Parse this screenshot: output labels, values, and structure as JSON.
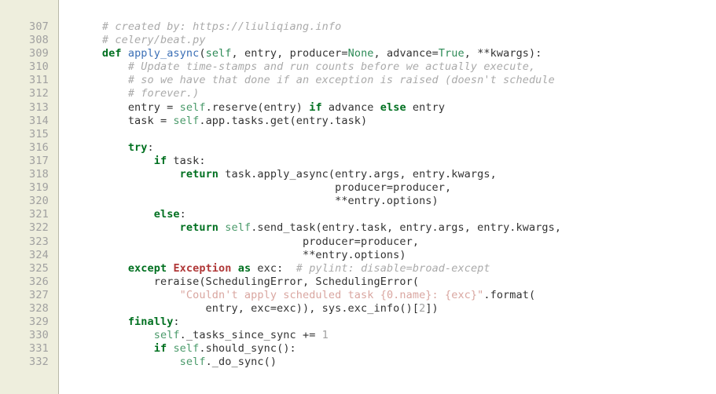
{
  "editor": {
    "name": "code-viewer",
    "language": "python",
    "theme_colors": {
      "background": "#ffffff",
      "gutter_background": "#eeeedd",
      "gutter_border": "#b8b8a8",
      "line_number": "#a0a0a0",
      "text": "#333333",
      "comment": "#aaaaaa",
      "keyword": "#007020",
      "constant": "#2e8b57",
      "self": "#4a9a6a",
      "function_name": "#3b6fb6",
      "exception": "#b03838",
      "string": "#d9a6a0",
      "number": "#a0a0a0"
    },
    "first_line_number": 307,
    "last_line_number": 332,
    "line_numbers": [
      "307",
      "308",
      "309",
      "310",
      "311",
      "312",
      "313",
      "314",
      "315",
      "316",
      "317",
      "318",
      "319",
      "320",
      "321",
      "322",
      "323",
      "324",
      "325",
      "326",
      "327",
      "328",
      "329",
      "330",
      "331",
      "332"
    ],
    "lines": [
      {
        "number": "307",
        "text": "    # created by: https://liuliqiang.info",
        "tokens": [
          {
            "t": "    ",
            "c": "t-plain"
          },
          {
            "t": "# created by: https://liuliqiang.info",
            "c": "t-comment"
          }
        ]
      },
      {
        "number": "308",
        "text": "    # celery/beat.py",
        "tokens": [
          {
            "t": "    ",
            "c": "t-plain"
          },
          {
            "t": "# celery/beat.py",
            "c": "t-comment"
          }
        ]
      },
      {
        "number": "309",
        "text": "    def apply_async(self, entry, producer=None, advance=True, **kwargs):",
        "tokens": [
          {
            "t": "    ",
            "c": "t-plain"
          },
          {
            "t": "def",
            "c": "t-kw"
          },
          {
            "t": " ",
            "c": "t-plain"
          },
          {
            "t": "apply_async",
            "c": "t-fn"
          },
          {
            "t": "(",
            "c": "t-plain"
          },
          {
            "t": "self",
            "c": "t-const"
          },
          {
            "t": ", entry, producer=",
            "c": "t-plain"
          },
          {
            "t": "None",
            "c": "t-const"
          },
          {
            "t": ", advance=",
            "c": "t-plain"
          },
          {
            "t": "True",
            "c": "t-const"
          },
          {
            "t": ", **kwargs):",
            "c": "t-plain"
          }
        ]
      },
      {
        "number": "310",
        "text": "        # Update time-stamps and run counts before we actually execute,",
        "tokens": [
          {
            "t": "        ",
            "c": "t-plain"
          },
          {
            "t": "# Update time-stamps and run counts before we actually execute,",
            "c": "t-comment"
          }
        ]
      },
      {
        "number": "311",
        "text": "        # so we have that done if an exception is raised (doesn't schedule",
        "tokens": [
          {
            "t": "        ",
            "c": "t-plain"
          },
          {
            "t": "# so we have that done if an exception is raised (doesn't schedule",
            "c": "t-comment"
          }
        ]
      },
      {
        "number": "312",
        "text": "        # forever.)",
        "tokens": [
          {
            "t": "        ",
            "c": "t-plain"
          },
          {
            "t": "# forever.)",
            "c": "t-comment"
          }
        ]
      },
      {
        "number": "313",
        "text": "        entry = self.reserve(entry) if advance else entry",
        "tokens": [
          {
            "t": "        entry = ",
            "c": "t-plain"
          },
          {
            "t": "self",
            "c": "t-self"
          },
          {
            "t": ".reserve(entry) ",
            "c": "t-plain"
          },
          {
            "t": "if",
            "c": "t-kw"
          },
          {
            "t": " advance ",
            "c": "t-plain"
          },
          {
            "t": "else",
            "c": "t-kw"
          },
          {
            "t": " entry",
            "c": "t-plain"
          }
        ]
      },
      {
        "number": "314",
        "text": "        task = self.app.tasks.get(entry.task)",
        "tokens": [
          {
            "t": "        task = ",
            "c": "t-plain"
          },
          {
            "t": "self",
            "c": "t-self"
          },
          {
            "t": ".app.tasks.get(entry.task)",
            "c": "t-plain"
          }
        ]
      },
      {
        "number": "315",
        "text": "",
        "tokens": []
      },
      {
        "number": "316",
        "text": "        try:",
        "tokens": [
          {
            "t": "        ",
            "c": "t-plain"
          },
          {
            "t": "try",
            "c": "t-kw"
          },
          {
            "t": ":",
            "c": "t-plain"
          }
        ]
      },
      {
        "number": "317",
        "text": "            if task:",
        "tokens": [
          {
            "t": "            ",
            "c": "t-plain"
          },
          {
            "t": "if",
            "c": "t-kw"
          },
          {
            "t": " task:",
            "c": "t-plain"
          }
        ]
      },
      {
        "number": "318",
        "text": "                return task.apply_async(entry.args, entry.kwargs,",
        "tokens": [
          {
            "t": "                ",
            "c": "t-plain"
          },
          {
            "t": "return",
            "c": "t-kw"
          },
          {
            "t": " task.apply_async(entry.args, entry.kwargs,",
            "c": "t-plain"
          }
        ]
      },
      {
        "number": "319",
        "text": "                                        producer=producer,",
        "tokens": [
          {
            "t": "                                        producer=producer,",
            "c": "t-plain"
          }
        ]
      },
      {
        "number": "320",
        "text": "                                        **entry.options)",
        "tokens": [
          {
            "t": "                                        **entry.options)",
            "c": "t-plain"
          }
        ]
      },
      {
        "number": "321",
        "text": "            else:",
        "tokens": [
          {
            "t": "            ",
            "c": "t-plain"
          },
          {
            "t": "else",
            "c": "t-kw"
          },
          {
            "t": ":",
            "c": "t-plain"
          }
        ]
      },
      {
        "number": "322",
        "text": "                return self.send_task(entry.task, entry.args, entry.kwargs,",
        "tokens": [
          {
            "t": "                ",
            "c": "t-plain"
          },
          {
            "t": "return",
            "c": "t-kw"
          },
          {
            "t": " ",
            "c": "t-plain"
          },
          {
            "t": "self",
            "c": "t-self"
          },
          {
            "t": ".send_task(entry.task, entry.args, entry.kwargs,",
            "c": "t-plain"
          }
        ]
      },
      {
        "number": "323",
        "text": "                                   producer=producer,",
        "tokens": [
          {
            "t": "                                   producer=producer,",
            "c": "t-plain"
          }
        ]
      },
      {
        "number": "324",
        "text": "                                   **entry.options)",
        "tokens": [
          {
            "t": "                                   **entry.options)",
            "c": "t-plain"
          }
        ]
      },
      {
        "number": "325",
        "text": "        except Exception as exc:  # pylint: disable=broad-except",
        "tokens": [
          {
            "t": "        ",
            "c": "t-plain"
          },
          {
            "t": "except",
            "c": "t-kw"
          },
          {
            "t": " ",
            "c": "t-plain"
          },
          {
            "t": "Exception",
            "c": "t-exc"
          },
          {
            "t": " ",
            "c": "t-plain"
          },
          {
            "t": "as",
            "c": "t-kw"
          },
          {
            "t": " exc:  ",
            "c": "t-plain"
          },
          {
            "t": "# pylint: disable=broad-except",
            "c": "t-comment"
          }
        ]
      },
      {
        "number": "326",
        "text": "            reraise(SchedulingError, SchedulingError(",
        "tokens": [
          {
            "t": "            reraise(SchedulingError, SchedulingError(",
            "c": "t-plain"
          }
        ]
      },
      {
        "number": "327",
        "text": "                \"Couldn't apply scheduled task {0.name}: {exc}\".format(",
        "tokens": [
          {
            "t": "                ",
            "c": "t-plain"
          },
          {
            "t": "\"Couldn't apply scheduled task {0.name}: {exc}\"",
            "c": "t-str"
          },
          {
            "t": ".format(",
            "c": "t-plain"
          }
        ]
      },
      {
        "number": "328",
        "text": "                    entry, exc=exc)), sys.exc_info()[2])",
        "tokens": [
          {
            "t": "                    entry, exc=exc)), sys.exc_info()[",
            "c": "t-plain"
          },
          {
            "t": "2",
            "c": "t-num"
          },
          {
            "t": "])",
            "c": "t-plain"
          }
        ]
      },
      {
        "number": "329",
        "text": "        finally:",
        "tokens": [
          {
            "t": "        ",
            "c": "t-plain"
          },
          {
            "t": "finally",
            "c": "t-kw"
          },
          {
            "t": ":",
            "c": "t-plain"
          }
        ]
      },
      {
        "number": "330",
        "text": "            self._tasks_since_sync += 1",
        "tokens": [
          {
            "t": "            ",
            "c": "t-plain"
          },
          {
            "t": "self",
            "c": "t-self"
          },
          {
            "t": "._tasks_since_sync += ",
            "c": "t-plain"
          },
          {
            "t": "1",
            "c": "t-num"
          }
        ]
      },
      {
        "number": "331",
        "text": "            if self.should_sync():",
        "tokens": [
          {
            "t": "            ",
            "c": "t-plain"
          },
          {
            "t": "if",
            "c": "t-kw"
          },
          {
            "t": " ",
            "c": "t-plain"
          },
          {
            "t": "self",
            "c": "t-self"
          },
          {
            "t": ".should_sync():",
            "c": "t-plain"
          }
        ]
      },
      {
        "number": "332",
        "text": "                self._do_sync()",
        "tokens": [
          {
            "t": "                ",
            "c": "t-plain"
          },
          {
            "t": "self",
            "c": "t-self"
          },
          {
            "t": "._do_sync()",
            "c": "t-plain"
          }
        ]
      }
    ]
  }
}
